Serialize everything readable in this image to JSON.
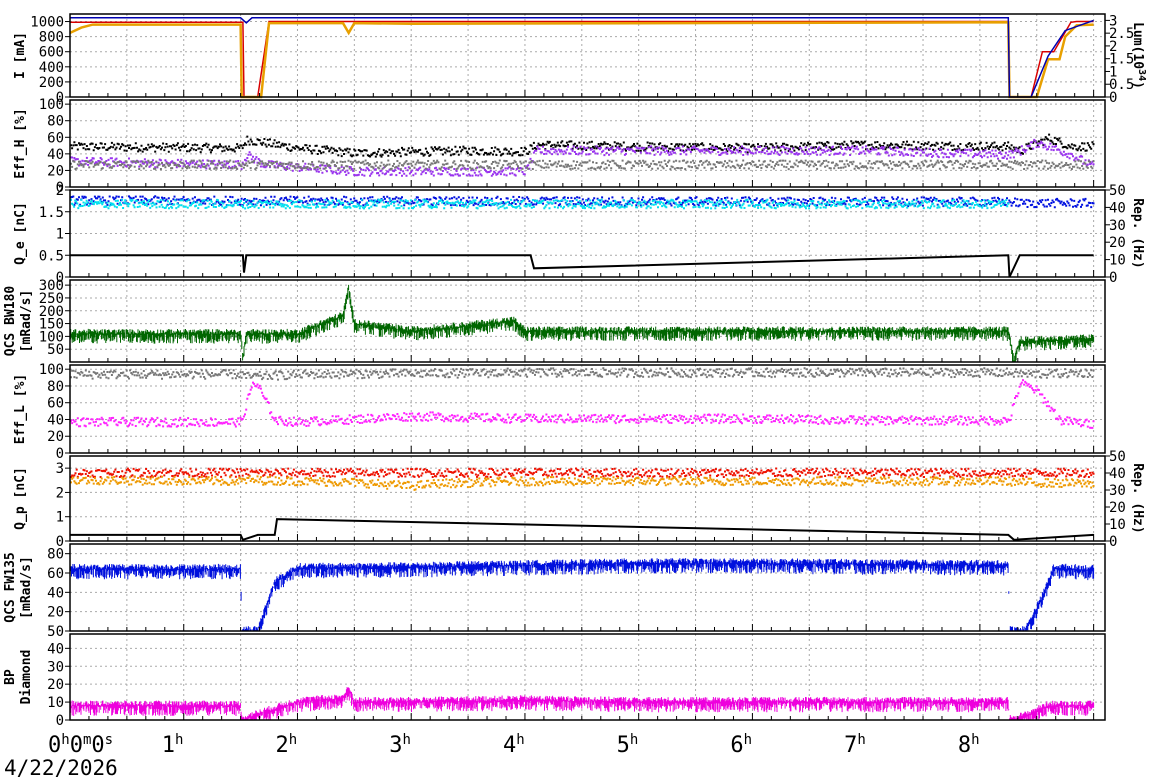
{
  "date_label": "4/22/2026",
  "colors": {
    "current_red": "#d80000",
    "current_orange": "#e8a000",
    "lumi_blue": "#0000b0",
    "eff_black": "#000000",
    "eff_purple": "#9933ee",
    "eff_gray": "#777777",
    "qe_blue": "#0010e0",
    "qe_cyan": "#00e0ee",
    "bw180_green": "#006600",
    "eff_magenta": "#ff22ff",
    "qp_red": "#ee1100",
    "qp_orange": "#ee9900",
    "fw135_blue": "#0010dd",
    "diamond_magenta": "#ee00dd",
    "grid": "#aaaaaa"
  },
  "chart_data": [
    {
      "id": "current",
      "type": "line",
      "ylabel": "I [mA]",
      "ylabel_right": "Lum(10^34)",
      "ylim": [
        0,
        1100
      ],
      "ylim_right": [
        0,
        3.25
      ],
      "yticks": [
        "0",
        "200",
        "400",
        "600",
        "800",
        "1000"
      ],
      "yticks_right": [
        "0",
        "0.5",
        "1",
        "1.5",
        "2",
        "2.5",
        "3"
      ],
      "series": [
        {
          "color_key": "current_red",
          "x": [
            0,
            1.52,
            1.53,
            1.65,
            1.75,
            8.25,
            8.26,
            8.45,
            8.55,
            8.65,
            8.8,
            8.85,
            9.0
          ],
          "values": [
            990,
            990,
            0,
            0,
            1000,
            1000,
            0,
            0,
            600,
            600,
            990,
            1000,
            1000
          ]
        },
        {
          "color_key": "current_orange",
          "x": [
            0,
            0.1,
            0.2,
            1.5,
            1.51,
            1.68,
            1.75,
            2.4,
            2.45,
            2.5,
            3.0,
            8.25,
            8.26,
            8.5,
            8.6,
            8.7,
            8.75,
            8.85,
            9.0
          ],
          "values": [
            850,
            920,
            960,
            960,
            0,
            0,
            980,
            980,
            850,
            980,
            970,
            990,
            0,
            0,
            500,
            500,
            800,
            950,
            960
          ]
        },
        {
          "color_key": "lumi_blue",
          "x": [
            0,
            1.5,
            1.55,
            1.6,
            8.25,
            8.26,
            8.45,
            8.6,
            8.75,
            9.0
          ],
          "values": [
            3.1,
            3.1,
            2.9,
            3.1,
            3.1,
            0,
            0,
            1.6,
            2.6,
            3.0
          ]
        }
      ]
    },
    {
      "id": "eff_h",
      "type": "scatter",
      "ylabel": "Eff_H [%]",
      "ylim": [
        0,
        105
      ],
      "yticks": [
        "0",
        "20",
        "40",
        "60",
        "80",
        "100"
      ],
      "series": [
        {
          "color_key": "eff_black",
          "x": [
            0,
            1.5,
            1.55,
            2.0,
            2.5,
            3.5,
            4.0,
            4.1,
            5.0,
            6.0,
            7.0,
            8.25,
            8.35,
            8.6,
            8.8,
            9.0
          ],
          "values": [
            50,
            48,
            58,
            48,
            42,
            45,
            44,
            52,
            50,
            48,
            52,
            50,
            45,
            60,
            50,
            50
          ]
        },
        {
          "color_key": "eff_purple",
          "x": [
            0,
            1.5,
            1.55,
            1.7,
            2.0,
            2.5,
            4.0,
            4.1,
            5.0,
            6.0,
            7.0,
            8.25,
            8.35,
            8.5,
            8.8,
            9.0
          ],
          "values": [
            32,
            28,
            40,
            28,
            25,
            20,
            20,
            45,
            45,
            45,
            45,
            40,
            45,
            55,
            40,
            25
          ]
        },
        {
          "color_key": "eff_gray",
          "x": [
            0,
            9.0
          ],
          "values": [
            28,
            28
          ]
        }
      ]
    },
    {
      "id": "qe",
      "type": "scatter",
      "ylabel": "Q_e [nC]",
      "ylabel_right": "Rep. (Hz)",
      "ylim": [
        0,
        2.0
      ],
      "ylim_right": [
        0,
        50
      ],
      "yticks": [
        "0",
        "0.5",
        "1",
        "1.5",
        "2"
      ],
      "yticks_right": [
        "0",
        "10",
        "20",
        "30",
        "40",
        "50"
      ],
      "series": [
        {
          "color_key": "qe_blue",
          "x": [
            0,
            8.25,
            8.35,
            9.0
          ],
          "values": [
            1.78,
            1.75,
            1.72,
            1.72
          ]
        },
        {
          "color_key": "qe_cyan",
          "x": [
            0,
            8.25
          ],
          "values": [
            1.7,
            1.7
          ]
        },
        {
          "color_key": "eff_black",
          "x": [
            0,
            1.52,
            1.53,
            1.55,
            4.05,
            4.08,
            8.25,
            8.26,
            8.35,
            9.0
          ],
          "values": [
            0.5,
            0.5,
            0.1,
            0.5,
            0.5,
            0.2,
            0.5,
            0.0,
            0.5,
            0.5
          ]
        }
      ]
    },
    {
      "id": "bw180",
      "type": "area",
      "ylabel": "QCS BW180",
      "ylabel2": "[mRad/s]",
      "ylim": [
        0,
        320
      ],
      "yticks": [
        "50",
        "100",
        "150",
        "200",
        "250",
        "300"
      ],
      "series": [
        {
          "color_key": "bw180_green",
          "x": [
            0,
            1.5,
            1.52,
            1.55,
            2.0,
            2.4,
            2.45,
            2.5,
            3.0,
            3.5,
            3.9,
            4.0,
            5.0,
            6.0,
            7.0,
            8.25,
            8.3,
            8.35,
            9.0
          ],
          "values": [
            110,
            110,
            20,
            110,
            110,
            180,
            290,
            150,
            120,
            140,
            160,
            120,
            120,
            120,
            120,
            120,
            0,
            80,
            90
          ]
        }
      ]
    },
    {
      "id": "eff_l",
      "type": "scatter",
      "ylabel": "Eff_L [%]",
      "ylim": [
        0,
        105
      ],
      "yticks": [
        "0",
        "20",
        "40",
        "60",
        "80",
        "100"
      ],
      "series": [
        {
          "color_key": "eff_gray",
          "x": [
            0,
            1.5,
            1.55,
            2.0,
            4.0,
            6.0,
            8.25,
            8.4,
            9.0
          ],
          "values": [
            95,
            95,
            92,
            95,
            97,
            97,
            97,
            95,
            97
          ]
        },
        {
          "color_key": "eff_magenta",
          "x": [
            0,
            1.5,
            1.6,
            1.65,
            1.8,
            2.0,
            3.0,
            4.0,
            5.0,
            6.0,
            7.0,
            8.25,
            8.35,
            8.5,
            8.7,
            9.0
          ],
          "values": [
            38,
            38,
            85,
            80,
            40,
            38,
            45,
            42,
            42,
            42,
            40,
            40,
            85,
            75,
            40,
            35
          ]
        }
      ]
    },
    {
      "id": "qp",
      "type": "scatter",
      "ylabel": "Q_p [nC]",
      "ylabel_right": "Rep. (Hz)",
      "ylim": [
        0,
        3.5
      ],
      "ylim_right": [
        0,
        50
      ],
      "yticks": [
        "0",
        "1",
        "2",
        "3"
      ],
      "yticks_right": [
        "0",
        "10",
        "20",
        "30",
        "40",
        "50"
      ],
      "series": [
        {
          "color_key": "qp_red",
          "x": [
            0,
            1.5,
            1.55,
            8.25,
            8.35,
            9.0
          ],
          "values": [
            2.85,
            2.85,
            2.85,
            2.85,
            2.85,
            2.85
          ]
        },
        {
          "color_key": "qp_orange",
          "x": [
            0,
            1.5,
            1.55,
            2.5,
            3.0,
            3.2,
            4.0,
            8.25,
            8.35,
            9.0
          ],
          "values": [
            2.55,
            2.5,
            2.55,
            2.45,
            2.3,
            2.4,
            2.5,
            2.5,
            2.45,
            2.4
          ]
        },
        {
          "color_key": "eff_black",
          "x": [
            0,
            1.5,
            1.52,
            1.65,
            1.8,
            1.82,
            8.25,
            8.3,
            9.0
          ],
          "values": [
            0.25,
            0.25,
            0.05,
            0.25,
            0.25,
            0.9,
            0.25,
            0.05,
            0.25
          ]
        }
      ]
    },
    {
      "id": "fw135",
      "type": "area",
      "ylabel": "QCS FW135",
      "ylabel2": "[mRad/s]",
      "ylim": [
        0,
        90
      ],
      "yticks": [
        "50",
        "20",
        "40",
        "60",
        "80"
      ],
      "series": [
        {
          "color_key": "fw135_blue",
          "x": [
            0,
            1.5,
            1.51,
            1.65,
            1.8,
            2.0,
            3.0,
            4.0,
            5.0,
            6.0,
            7.0,
            8.25,
            8.26,
            8.4,
            8.55,
            8.65,
            9.0
          ],
          "values": [
            64,
            64,
            0,
            0,
            50,
            65,
            66,
            68,
            70,
            70,
            69,
            68,
            0,
            0,
            35,
            65,
            63
          ]
        }
      ]
    },
    {
      "id": "diamond",
      "type": "area",
      "ylabel": "BP",
      "ylabel2": "Diamond",
      "ylim": [
        0,
        48
      ],
      "yticks": [
        "0",
        "10",
        "20",
        "30",
        "40"
      ],
      "series": [
        {
          "color_key": "diamond_magenta",
          "x": [
            0,
            1.5,
            1.51,
            1.65,
            2.0,
            2.4,
            2.45,
            2.5,
            3.0,
            4.0,
            5.0,
            6.0,
            7.0,
            8.25,
            8.26,
            8.4,
            8.6,
            9.0
          ],
          "values": [
            8,
            8,
            0,
            3,
            10,
            12,
            17,
            10,
            10,
            11,
            10,
            10,
            10,
            10,
            0,
            2,
            8,
            8
          ]
        }
      ]
    }
  ],
  "x_axis": {
    "range": [
      0,
      9.1
    ],
    "ticks": [
      {
        "h": "0",
        "suffix": "h",
        "rest": "0m0s"
      },
      {
        "h": "1",
        "suffix": "h",
        "rest": ""
      },
      {
        "h": "2",
        "suffix": "h",
        "rest": ""
      },
      {
        "h": "3",
        "suffix": "h",
        "rest": ""
      },
      {
        "h": "4",
        "suffix": "h",
        "rest": ""
      },
      {
        "h": "5",
        "suffix": "h",
        "rest": ""
      },
      {
        "h": "6",
        "suffix": "h",
        "rest": ""
      },
      {
        "h": "7",
        "suffix": "h",
        "rest": ""
      },
      {
        "h": "8",
        "suffix": "h",
        "rest": ""
      }
    ]
  }
}
